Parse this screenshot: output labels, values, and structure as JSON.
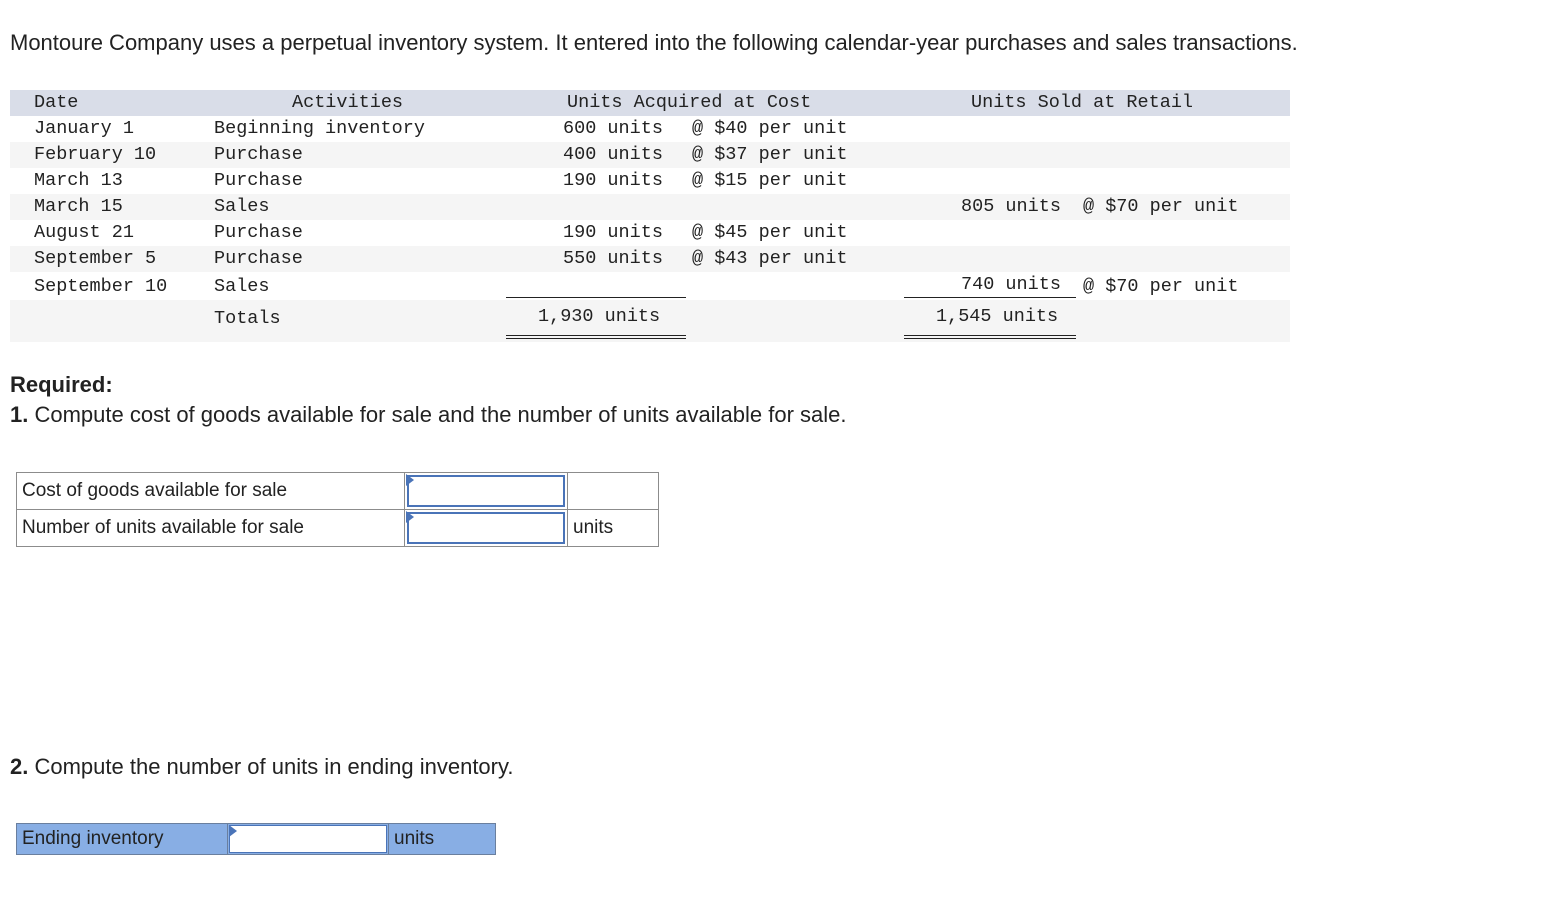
{
  "intro": "Montoure Company uses a perpetual inventory system. It entered into the following calendar-year purchases and sales transactions.",
  "table": {
    "headers": {
      "date": "Date",
      "activities": "Activities",
      "acquired": "Units Acquired at Cost",
      "sold": "Units Sold at Retail"
    },
    "rows": [
      {
        "date": "January 1",
        "activity": "Beginning inventory",
        "acq_units": "600 units",
        "acq_price": "@ $40 per unit",
        "sold_units": "",
        "sold_price": ""
      },
      {
        "date": "February 10",
        "activity": "Purchase",
        "acq_units": "400 units",
        "acq_price": "@ $37 per unit",
        "sold_units": "",
        "sold_price": ""
      },
      {
        "date": "March 13",
        "activity": "Purchase",
        "acq_units": "190 units",
        "acq_price": "@ $15 per unit",
        "sold_units": "",
        "sold_price": ""
      },
      {
        "date": "March 15",
        "activity": "Sales",
        "acq_units": "",
        "acq_price": "",
        "sold_units": "805 units",
        "sold_price": "@ $70 per unit"
      },
      {
        "date": "August 21",
        "activity": "Purchase",
        "acq_units": "190 units",
        "acq_price": "@ $45 per unit",
        "sold_units": "",
        "sold_price": ""
      },
      {
        "date": "September 5",
        "activity": "Purchase",
        "acq_units": "550 units",
        "acq_price": "@ $43 per unit",
        "sold_units": "",
        "sold_price": ""
      },
      {
        "date": "September 10",
        "activity": "Sales",
        "acq_units": "",
        "acq_price": "",
        "sold_units": "740 units",
        "sold_price": "@ $70 per unit"
      }
    ],
    "totals": {
      "label": "Totals",
      "acq_units": "1,930 units",
      "sold_units": "1,545 units"
    }
  },
  "required": {
    "title": "Required:",
    "q1_num": "1.",
    "q1_text": "Compute cost of goods available for sale and the number of units available for sale.",
    "q1_rows": [
      {
        "label": "Cost of goods available for sale",
        "value": "",
        "unit": ""
      },
      {
        "label": "Number of units available for sale",
        "value": "",
        "unit": "units"
      }
    ],
    "q2_num": "2.",
    "q2_text": "Compute the number of units in ending inventory.",
    "q2_row": {
      "label": "Ending inventory",
      "value": "",
      "unit": "units"
    }
  }
}
